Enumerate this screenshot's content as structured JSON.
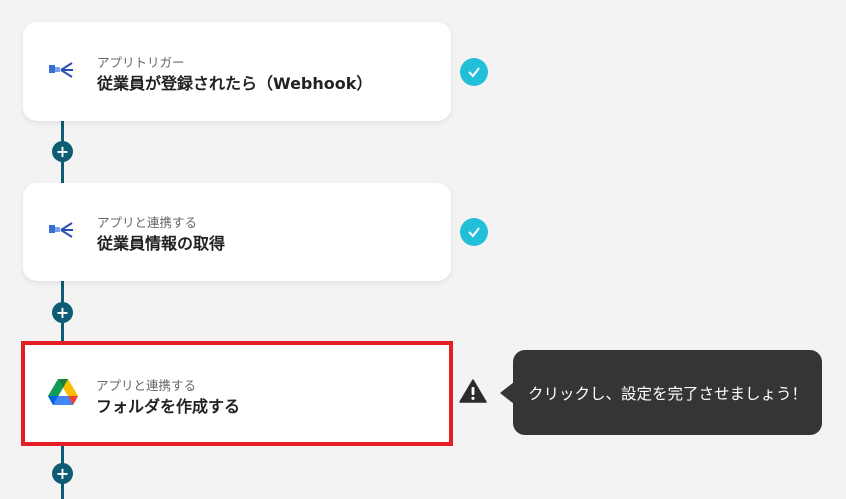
{
  "flow": {
    "steps": [
      {
        "subtitle": "アプリトリガー",
        "title": "従業員が登録されたら（Webhook）",
        "icon": "hr-app-icon",
        "status": "complete"
      },
      {
        "subtitle": "アプリと連携する",
        "title": "従業員情報の取得",
        "icon": "hr-app-icon",
        "status": "complete"
      },
      {
        "subtitle": "アプリと連携する",
        "title": "フォルダを作成する",
        "icon": "google-drive-icon",
        "status": "warning"
      }
    ],
    "add_label": "+",
    "tooltip": "クリックし、設定を完了させましょう！"
  },
  "colors": {
    "connector": "#0d5c73",
    "check": "#22bfd9",
    "highlight": "#e51e25",
    "tooltip_bg": "#353535"
  }
}
